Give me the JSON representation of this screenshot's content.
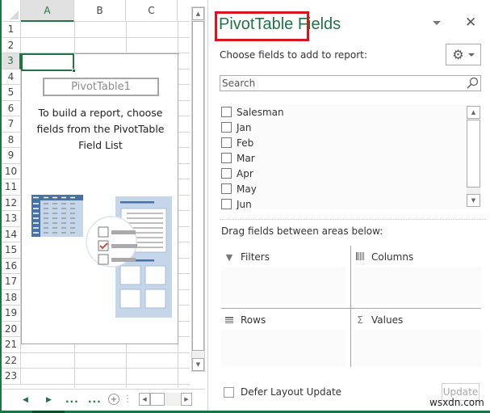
{
  "spreadsheet": {
    "columns": [
      {
        "label": "A",
        "active": true
      },
      {
        "label": "B",
        "active": false
      },
      {
        "label": "C",
        "active": false
      }
    ],
    "rows": [
      "1",
      "2",
      "3",
      "4",
      "5",
      "6",
      "7",
      "8",
      "9",
      "10",
      "11",
      "12",
      "13",
      "14",
      "15",
      "16",
      "17",
      "18",
      "19",
      "20",
      "21",
      "22",
      "23"
    ],
    "active_row": "3",
    "selected_cell": "A3",
    "pivot_placeholder": {
      "name": "PivotTable1",
      "instruction": "To build a report, choose fields from the PivotTable Field List"
    },
    "footer": {
      "prev_sheet_icon": "triangle-left",
      "next_sheet_icon": "triangle-right",
      "more_left": "...",
      "more_right": "...",
      "add_sheet_icon": "plus-circle"
    }
  },
  "field_pane": {
    "title": "PivotTable Fields",
    "title_highlight_color": "#d9141f",
    "accent_color": "#217346",
    "choose_label": "Choose fields to add to report:",
    "tools_icon": "gear-icon",
    "search": {
      "placeholder": "Search",
      "value": ""
    },
    "fields": [
      {
        "label": "Salesman",
        "checked": false
      },
      {
        "label": "Jan",
        "checked": false
      },
      {
        "label": "Feb",
        "checked": false
      },
      {
        "label": "Mar",
        "checked": false
      },
      {
        "label": "Apr",
        "checked": false
      },
      {
        "label": "May",
        "checked": false
      },
      {
        "label": "Jun",
        "checked": false
      }
    ],
    "drag_label": "Drag fields between areas below:",
    "areas": {
      "filters": {
        "label": "Filters",
        "icon": "filter-icon"
      },
      "columns": {
        "label": "Columns",
        "icon": "columns-icon"
      },
      "rows": {
        "label": "Rows",
        "icon": "rows-icon"
      },
      "values": {
        "label": "Values",
        "icon": "sigma-icon",
        "glyph": "Σ"
      }
    },
    "defer_label": "Defer Layout Update",
    "defer_checked": false,
    "update_label": "Update"
  },
  "watermark": "wsxdn.com"
}
